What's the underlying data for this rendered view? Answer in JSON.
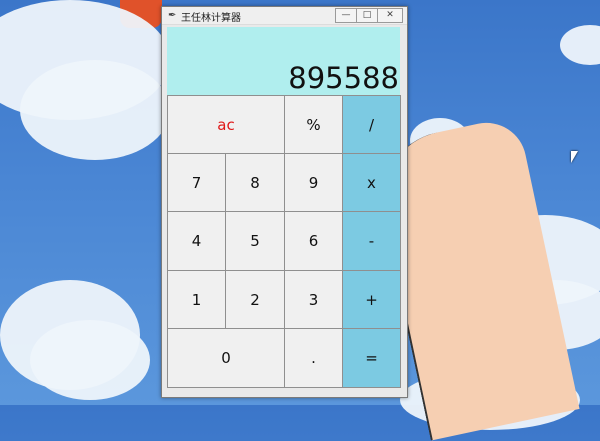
{
  "window": {
    "title": "王任林计算器",
    "icon": "feather-icon",
    "controls": {
      "minimize": "—",
      "maximize": "□",
      "close": "✕"
    }
  },
  "display": {
    "value": "895588"
  },
  "keys": {
    "ac": "ac",
    "percent": "%",
    "divide": "/",
    "k7": "7",
    "k8": "8",
    "k9": "9",
    "multiply": "x",
    "k4": "4",
    "k5": "5",
    "k6": "6",
    "minus": "-",
    "k1": "1",
    "k2": "2",
    "k3": "3",
    "plus": "+",
    "k0": "0",
    "dot": ".",
    "equals": "="
  },
  "colors": {
    "display_bg": "#b0eeee",
    "operator_bg": "#7ccae2",
    "clear_text": "#e01818"
  }
}
